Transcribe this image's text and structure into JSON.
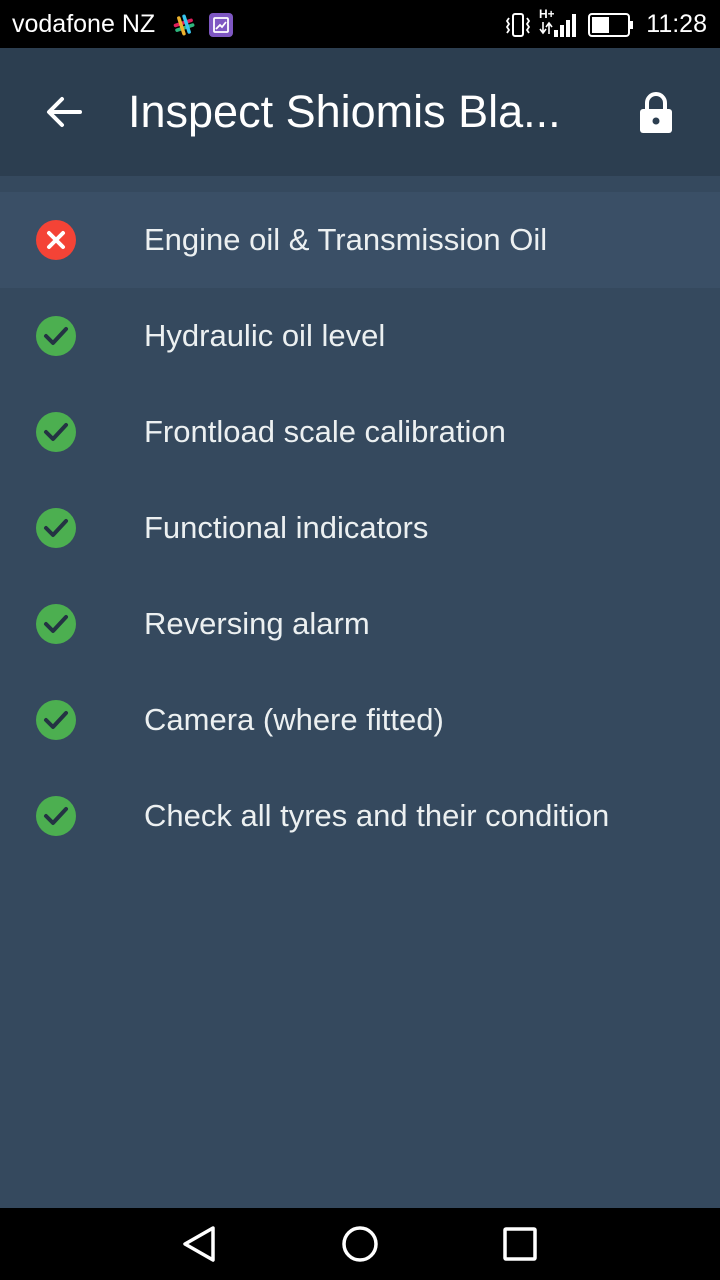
{
  "status_bar": {
    "carrier": "vodafone NZ",
    "network": "H+",
    "time": "11:28",
    "icons": [
      "slack-icon",
      "gallery-app-icon",
      "vibrate-icon",
      "data-arrows-icon",
      "signal-icon",
      "battery-icon"
    ],
    "battery_level_percent": 50
  },
  "app_bar": {
    "title": "Inspect Shiomis Bla...",
    "icons": [
      "back-arrow-icon",
      "lock-icon"
    ]
  },
  "checklist": [
    {
      "label": "Engine oil & Transmission Oil",
      "status": "fail"
    },
    {
      "label": "Hydraulic oil level",
      "status": "pass"
    },
    {
      "label": "Frontload scale calibration",
      "status": "pass"
    },
    {
      "label": "Functional indicators",
      "status": "pass"
    },
    {
      "label": "Reversing alarm",
      "status": "pass"
    },
    {
      "label": "Camera (where fitted)",
      "status": "pass"
    },
    {
      "label": "Check all tyres and their condition",
      "status": "pass"
    }
  ],
  "nav_bar": {
    "icons": [
      "back-triangle-icon",
      "home-circle-icon",
      "recents-square-icon"
    ]
  },
  "colors": {
    "background": "#35495e",
    "app_bar": "#2c3e50",
    "highlight_row": "#3a4f66",
    "pass": "#4caf50",
    "fail": "#f44336"
  }
}
